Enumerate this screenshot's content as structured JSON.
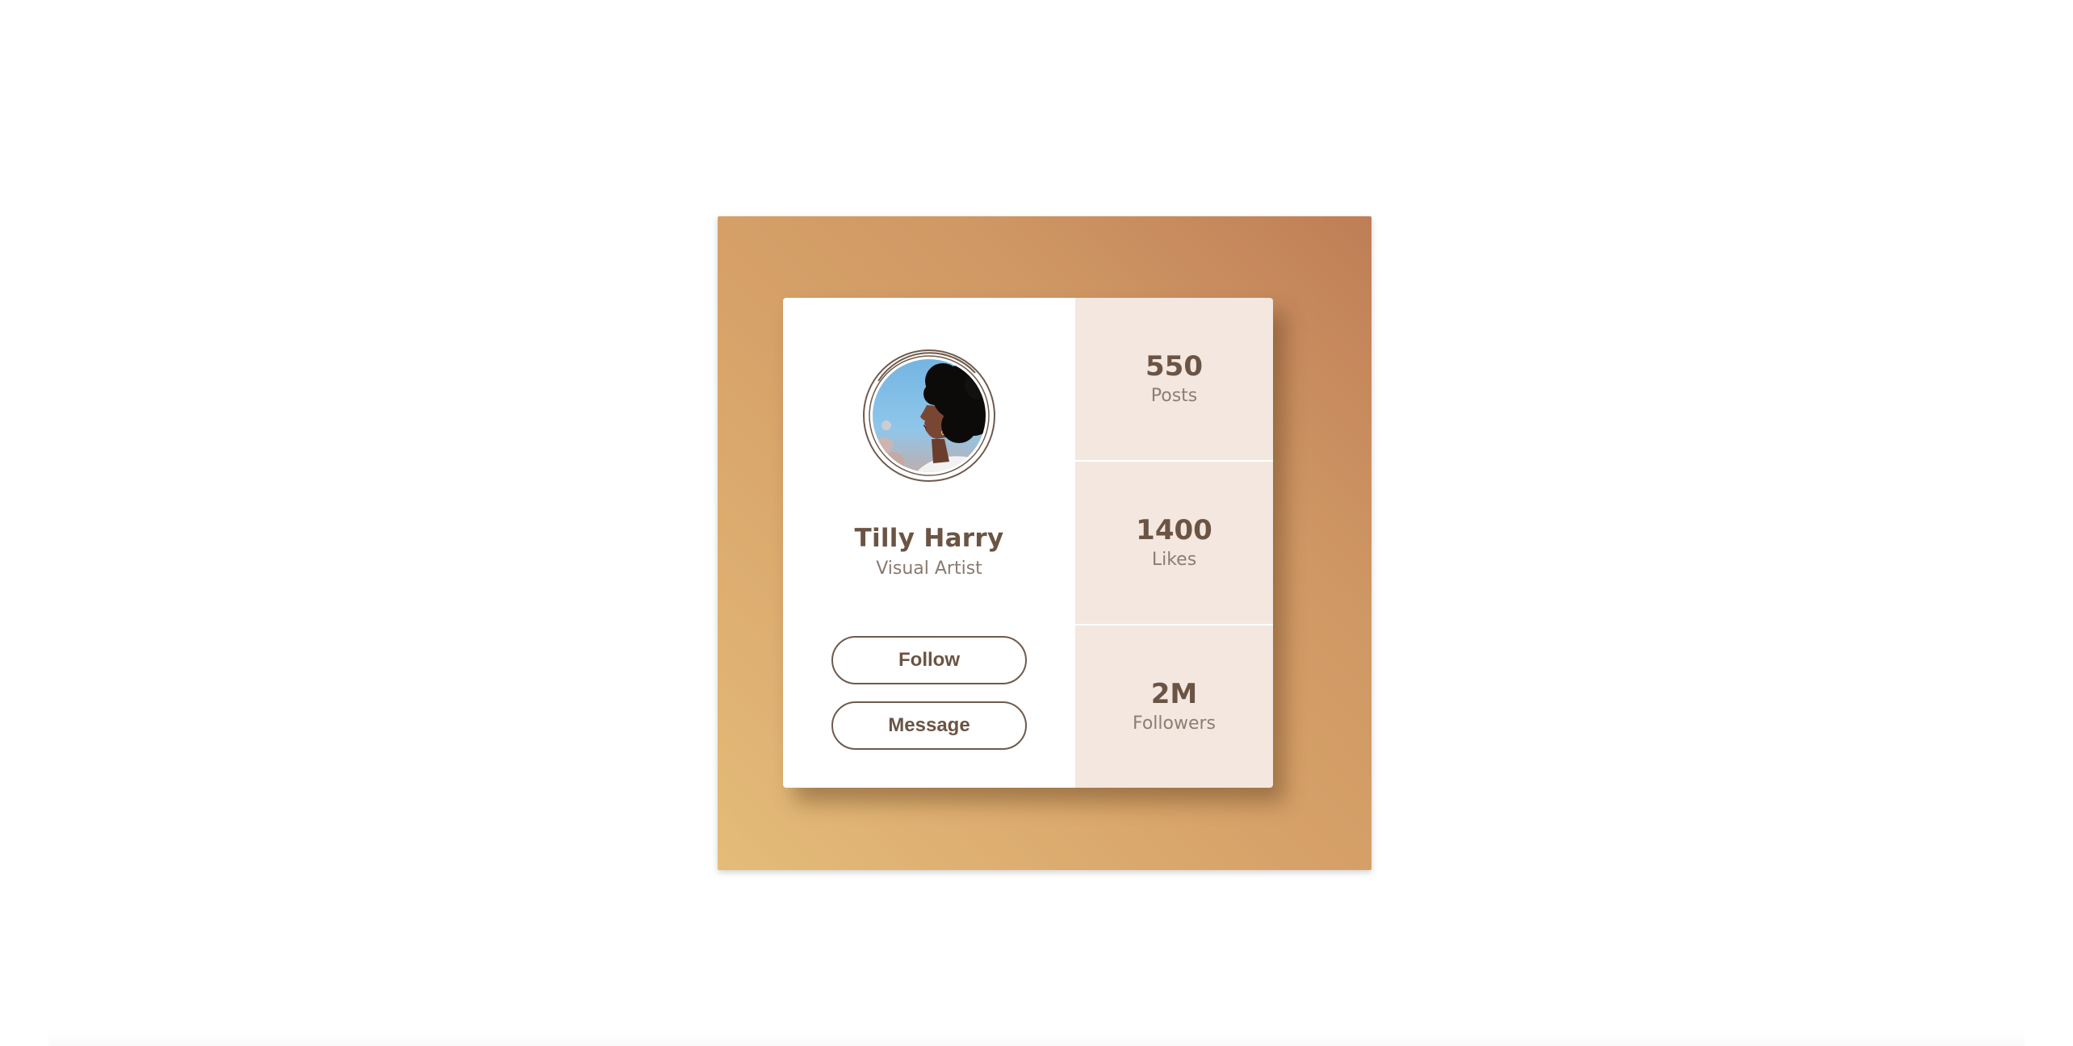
{
  "profile": {
    "name": "Tilly Harry",
    "role": "Visual Artist"
  },
  "actions": {
    "follow_label": "Follow",
    "message_label": "Message"
  },
  "stats": [
    {
      "value": "550",
      "label": "Posts"
    },
    {
      "value": "1400",
      "label": "Likes"
    },
    {
      "value": "2M",
      "label": "Followers"
    }
  ],
  "colors": {
    "frame_gradient_start": "#bf7e56",
    "frame_gradient_end": "#e4bc79",
    "card_left_bg": "#ffffff",
    "card_right_bg": "#f3e7df",
    "text_primary": "#6b5444",
    "text_secondary": "#8a7a70"
  }
}
